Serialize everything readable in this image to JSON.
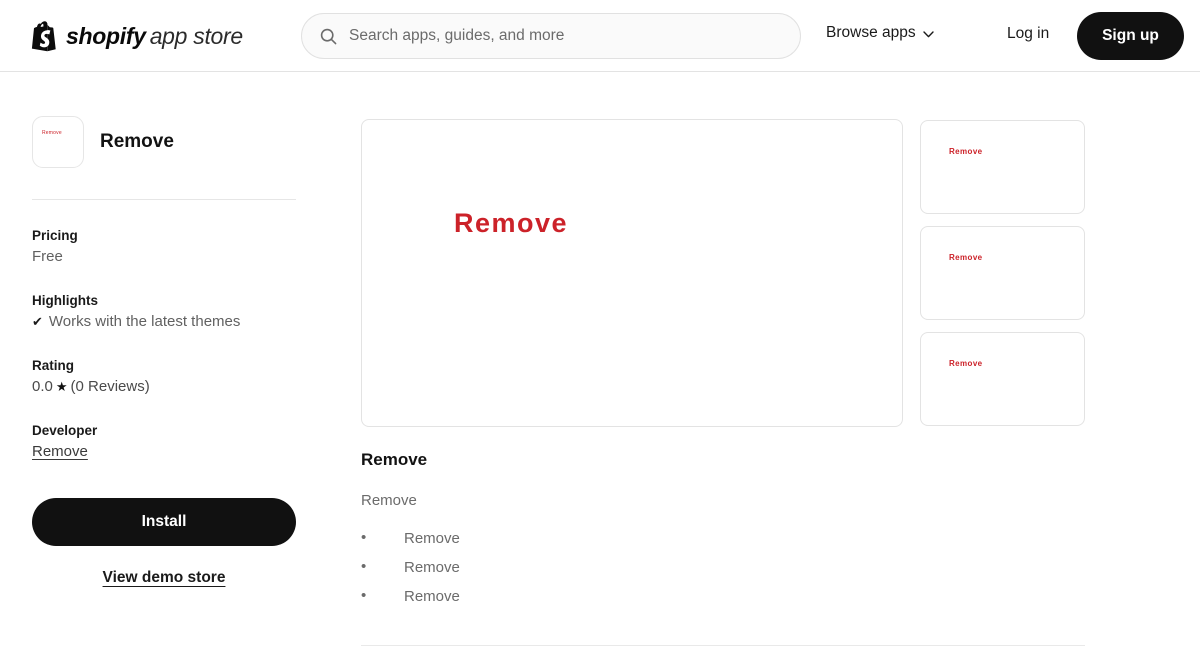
{
  "header": {
    "logo": {
      "icon": "shopify-bag-icon",
      "brand": "shopify",
      "suffix": "app store"
    },
    "search": {
      "icon": "search-icon",
      "placeholder": "Search apps, guides, and more",
      "value": ""
    },
    "browse_apps": "Browse apps",
    "chevron_icon": "chevron-down-icon",
    "log_in": "Log in",
    "sign_up": "Sign up"
  },
  "sidebar": {
    "app_icon_text": "Remove",
    "app_title": "Remove",
    "pricing": {
      "label": "Pricing",
      "value": "Free"
    },
    "highlights": {
      "label": "Highlights",
      "check_icon": "✔",
      "items": [
        "Works with the latest themes"
      ]
    },
    "rating": {
      "label": "Rating",
      "score": "0.0",
      "star_icon": "★",
      "reviews": "(0 Reviews)"
    },
    "developer": {
      "label": "Developer",
      "name": "Remove"
    },
    "install_label": "Install",
    "demo_label": "View demo store"
  },
  "media": {
    "hero": {
      "text": "Remove"
    },
    "thumbnails": [
      {
        "text": "Remove"
      },
      {
        "text": "Remove"
      },
      {
        "text": "Remove"
      }
    ]
  },
  "description": {
    "title": "Remove",
    "paragraph": "Remove",
    "bullets": [
      "Remove",
      "Remove",
      "Remove"
    ]
  },
  "colors": {
    "accent_red": "#cc2229",
    "button_black": "#111111",
    "border_gray": "#e3e3e3",
    "text_muted": "#6b6b6b"
  }
}
